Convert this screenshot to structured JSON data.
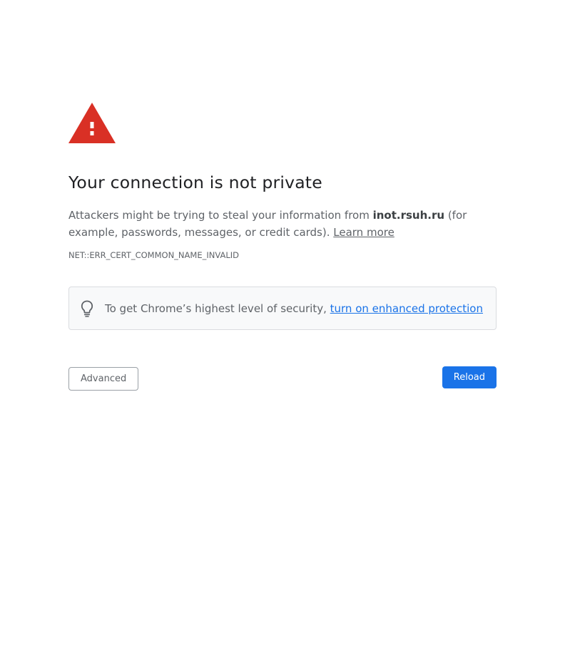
{
  "page": {
    "title": "Your connection is not private",
    "explanation_prefix": "Attackers might be trying to steal your information from ",
    "host": "inot.rsuh.ru",
    "explanation_suffix": " (for example, passwords, messages, or credit cards). ",
    "learn_more_label": "Learn more",
    "error_code": "NET::ERR_CERT_COMMON_NAME_INVALID"
  },
  "promo": {
    "text": "To get Chrome’s highest level of security, ",
    "link_label": "turn on enhanced protection",
    "icon": "lightbulb-icon"
  },
  "buttons": {
    "advanced_label": "Advanced",
    "reload_label": "Reload"
  },
  "icons": {
    "warning": "warning-triangle-icon",
    "bulb": "lightbulb-icon"
  },
  "colors": {
    "warning_red": "#d93025",
    "title_text": "#202124",
    "body_text": "#5f6368",
    "link_blue": "#1a73e8",
    "promo_bg": "#f8f9fa",
    "promo_border": "#dadce0",
    "reload_bg": "#1a73e8"
  }
}
